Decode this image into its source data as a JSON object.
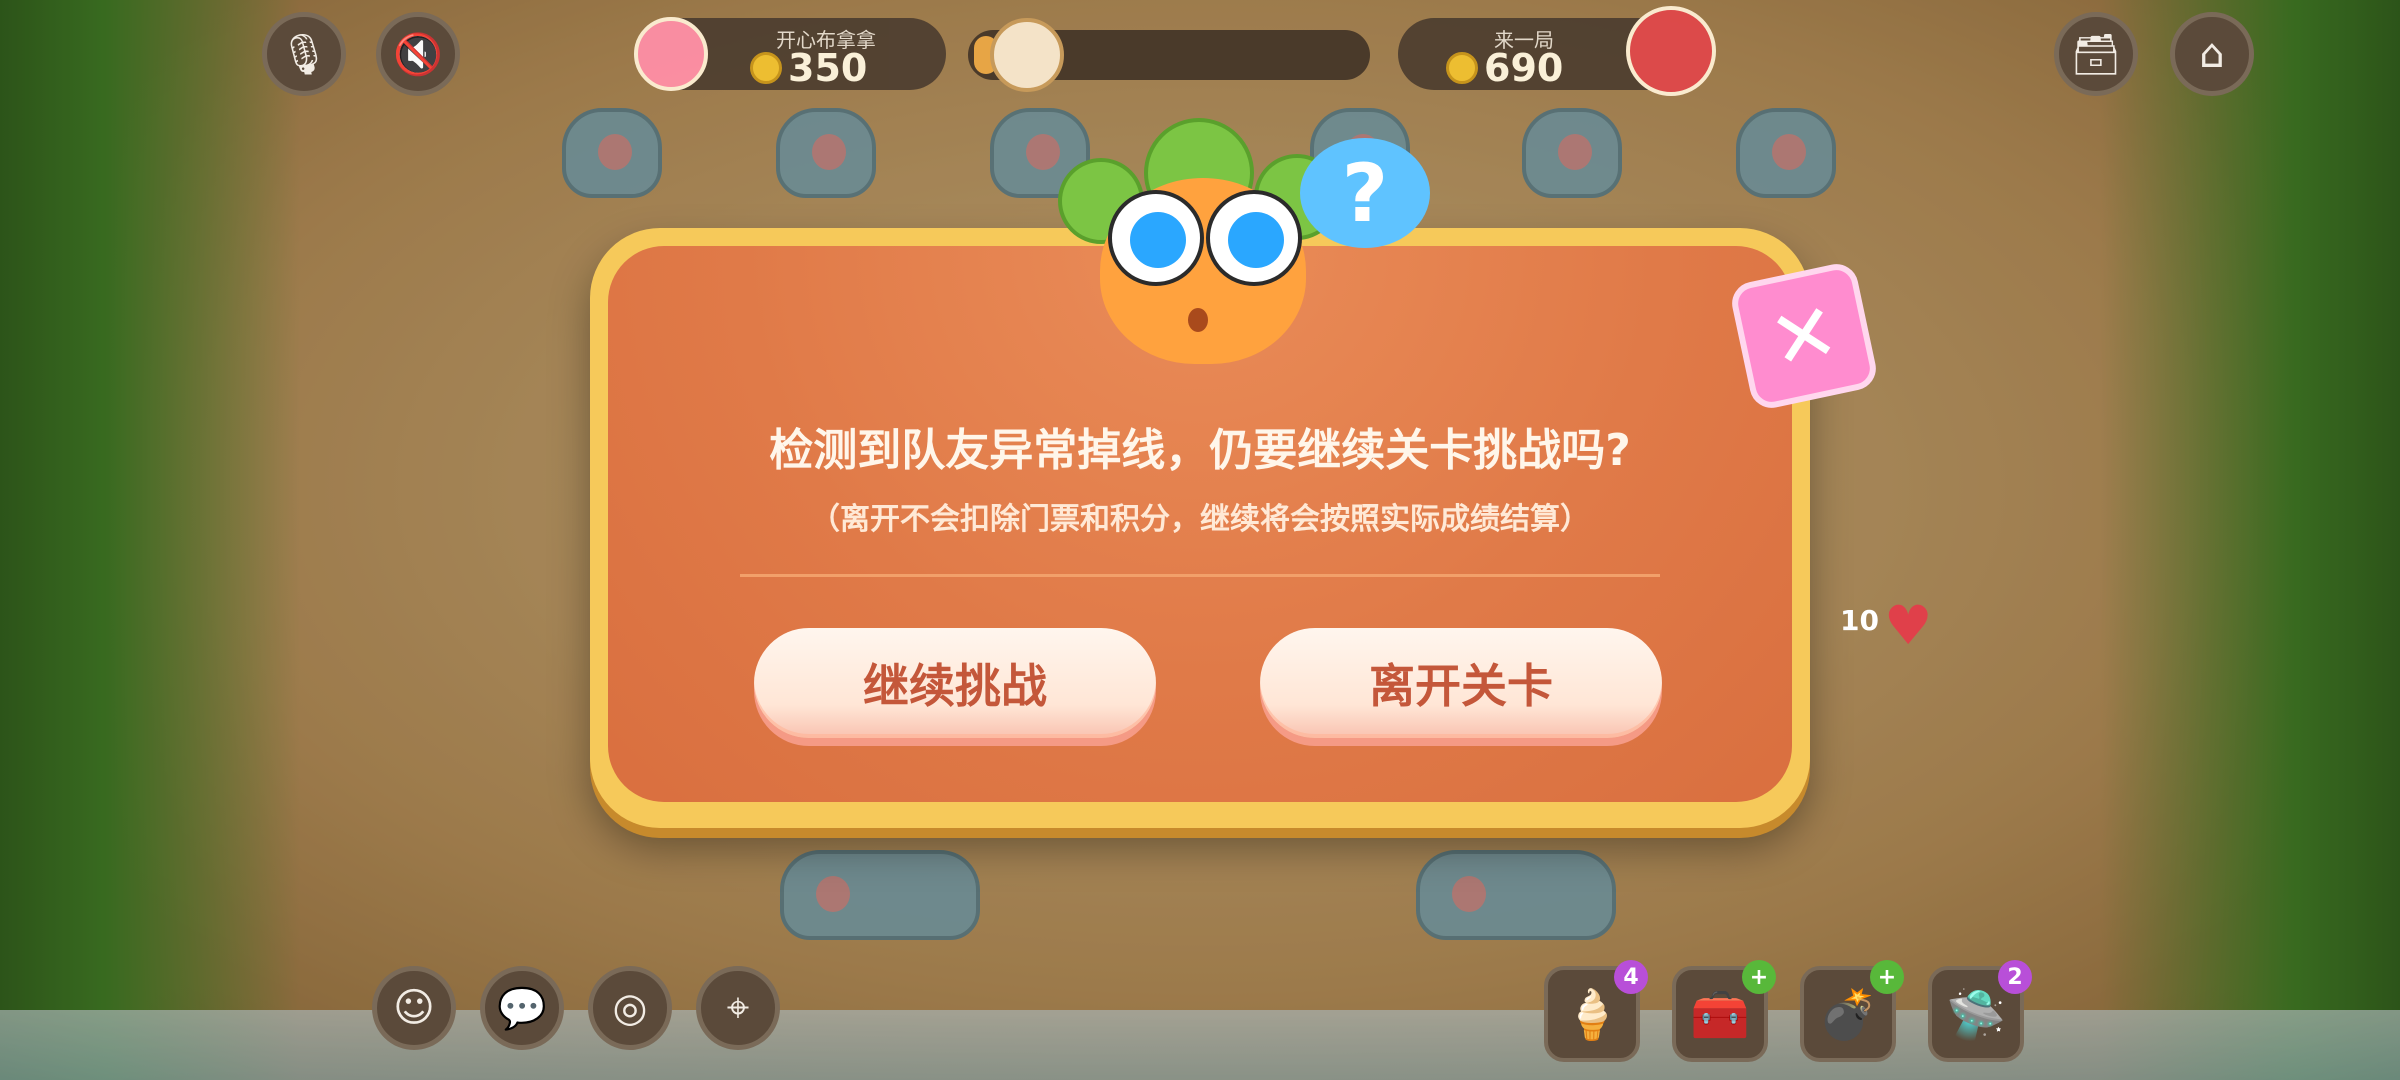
{
  "hud": {
    "mic_icon": "mic-off-icon",
    "sound_icon": "sound-off-icon",
    "player1": {
      "name": "开心布拿拿",
      "score": "350"
    },
    "player2": {
      "name": "来一局",
      "score": "690"
    },
    "progress": 0.05,
    "archive_icon": "archive-icon",
    "home_icon": "home-icon"
  },
  "dialog": {
    "title": "检测到队友异常掉线，仍要继续关卡挑战吗?",
    "subtitle": "（离开不会扣除门票和积分，继续将会按照实际成绩结算）",
    "continue_label": "继续挑战",
    "leave_label": "离开关卡",
    "close_icon": "close-icon",
    "question_mark": "?"
  },
  "lives": "10",
  "bottom_left": [
    "smile-icon",
    "chat-icon",
    "swirl-icon",
    "location-icon"
  ],
  "items": [
    {
      "icon": "popsicle-icon",
      "badge": "4"
    },
    {
      "icon": "medkit-icon",
      "badge": "+"
    },
    {
      "icon": "bomb-icon",
      "badge": "+"
    },
    {
      "icon": "ufo-icon",
      "badge": "2"
    }
  ],
  "colors": {
    "dialog_bg": "#e07a48",
    "dialog_frame": "#f6c95a",
    "button_text": "#c4573a",
    "close_bg": "#ff8ccf"
  }
}
